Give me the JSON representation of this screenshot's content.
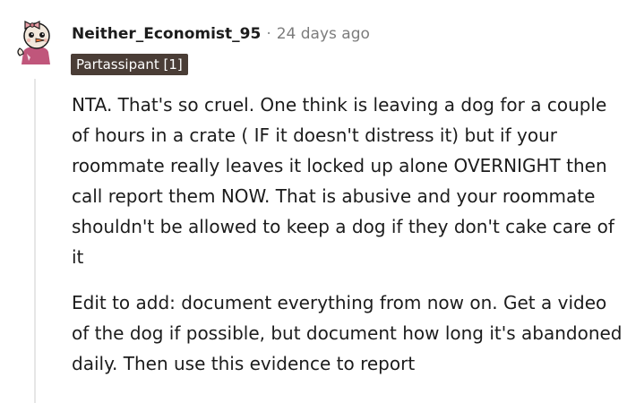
{
  "comment": {
    "author": "Neither_Economist_95",
    "separator": "·",
    "timestamp": "24 days ago",
    "flair": "Partassipant [1]",
    "paragraphs": [
      "NTA. That's so cruel. One think is leaving a dog for a couple of hours in a crate ( IF it doesn't distress it) but if your roommate really leaves it locked up alone OVERNIGHT then call report them NOW. That is abusive and your roommate shouldn't be allowed to keep a dog if they don't cake care of it",
      "Edit to add: document everything from now on. Get a video of the dog if possible, but document how long it's abandoned daily. Then use this evidence to report"
    ]
  },
  "avatar": {
    "icon": "snoo-avatar-icon",
    "colors": {
      "face": "#f2e8dc",
      "bow": "#e8a0a8",
      "eyes": "#1a1a1a",
      "nose": "#e8743a",
      "shirt": "#c0567b"
    }
  },
  "colors": {
    "flair_bg": "#4a3d36",
    "flair_text": "#ffffff",
    "meta": "#7c7c7c",
    "thread_line": "#e6e6e6",
    "text": "#1c1c1c"
  }
}
